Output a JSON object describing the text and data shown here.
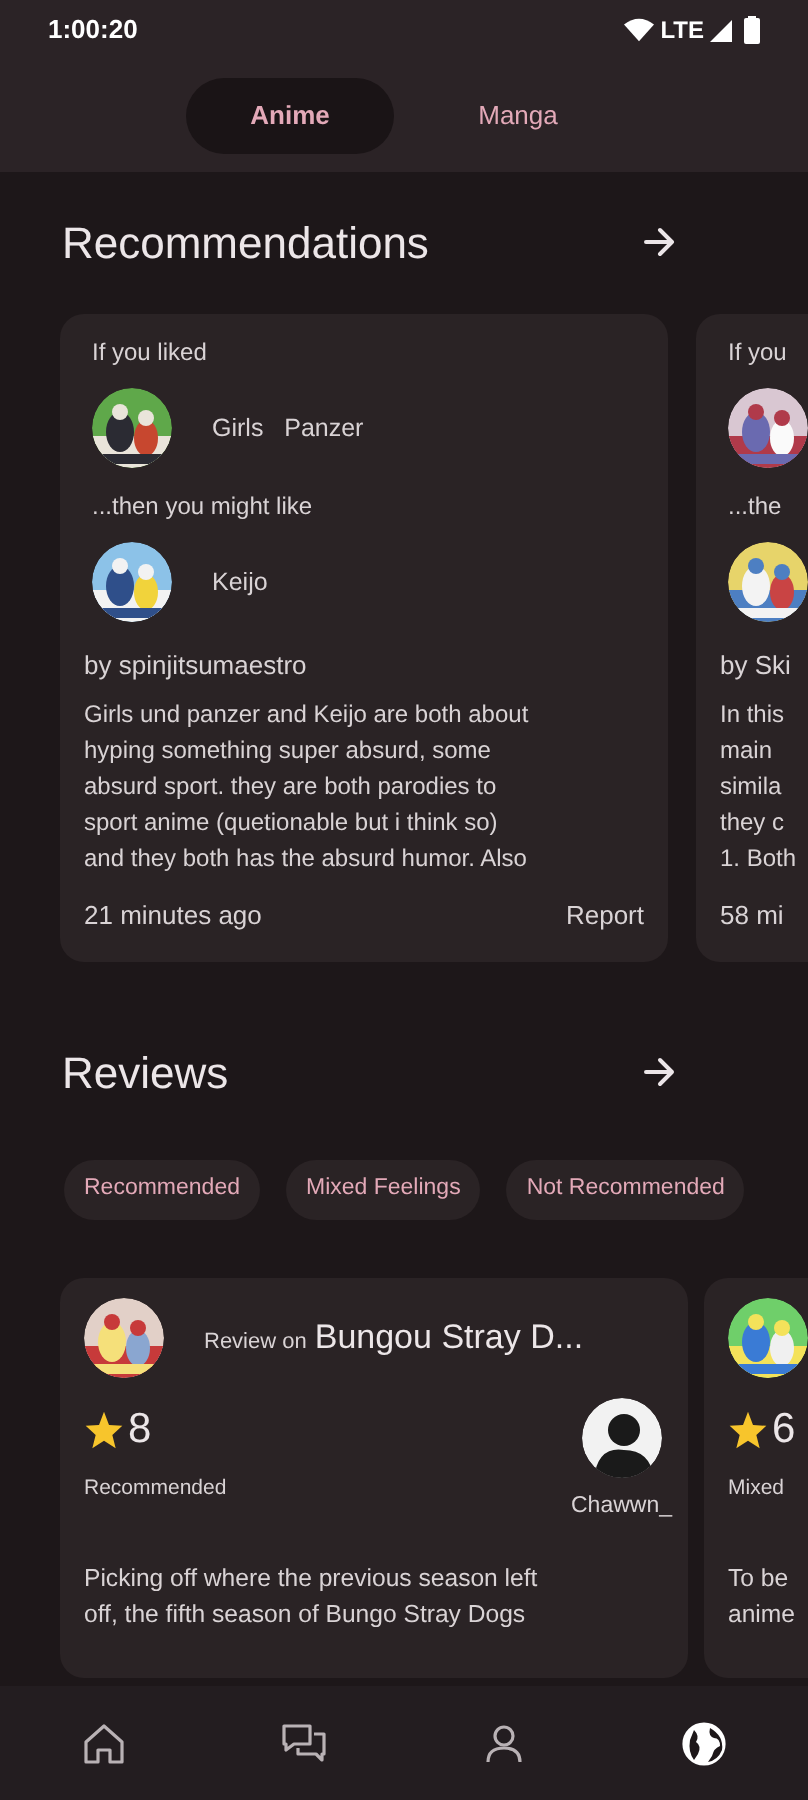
{
  "status_bar": {
    "time": "1:00:20",
    "network": "LTE"
  },
  "tabs": [
    {
      "label": "Anime",
      "selected": true
    },
    {
      "label": "Manga",
      "selected": false
    }
  ],
  "recommendations": {
    "title": "Recommendations",
    "cards": [
      {
        "liked_label": "If you liked",
        "liked_title": "Girls   Panzer",
        "then_label": "...then you might like",
        "suggested_title": "Keijo",
        "author": "by spinjitsumaestro",
        "text_lines": [
          "Girls und panzer and Keijo are both about",
          "hyping something super absurd, some",
          "absurd sport. they are both parodies to",
          "sport anime (quetionable but i think so)",
          "and they both has the absurd humor. Also"
        ],
        "time": "21 minutes ago",
        "report": "Report"
      },
      {
        "liked_label": "If you",
        "then_label": "...the",
        "author": "by Ski",
        "text_lines": [
          "In this",
          "main",
          "simila",
          "they c",
          "1. Both"
        ],
        "time": "58 mi"
      }
    ]
  },
  "reviews": {
    "title": "Reviews",
    "filters": [
      "Recommended",
      "Mixed Feelings",
      "Not Recommended"
    ],
    "cards": [
      {
        "review_on": "Review on",
        "title": "Bungou Stray D...",
        "score": "8",
        "verdict": "Recommended",
        "user": "Chawwn_",
        "text_lines": [
          "Picking off where the previous season left",
          "off, the fifth season of Bungo Stray Dogs"
        ]
      },
      {
        "score": "6",
        "verdict": "Mixed",
        "text_lines": [
          "To be",
          "anime"
        ]
      }
    ]
  },
  "nav": [
    {
      "kind": "home",
      "selected": false
    },
    {
      "kind": "chat",
      "selected": false
    },
    {
      "kind": "profile",
      "selected": false
    },
    {
      "kind": "globe",
      "selected": true
    }
  ]
}
